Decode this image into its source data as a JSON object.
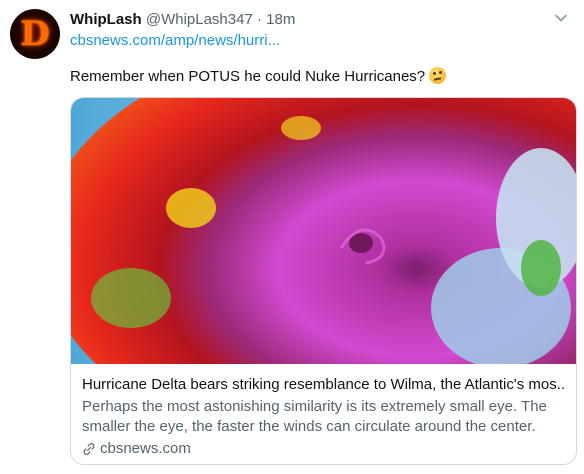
{
  "tweet": {
    "display_name": "WhipLash",
    "handle": "@WhipLash347",
    "separator": "·",
    "timestamp": "18m",
    "link_text": "cbsnews.com/amp/news/hurri...",
    "body_text": "Remember when POTUS he could Nuke Hurricanes?",
    "avatar_letter": "D"
  },
  "card": {
    "title": "Hurricane Delta bears striking resemblance to Wilma, the Atlantic's mos...",
    "description": "Perhaps the most astonishing similarity is its extremely small eye. The smaller the eye, the faster the winds can circulate around the center.",
    "source": "cbsnews.com"
  },
  "icons": {
    "more": "chevron-down-icon",
    "emoji": "thinking-face-emoji",
    "link": "link-icon"
  },
  "colors": {
    "link": "#1b95e0",
    "secondary_text": "#536471",
    "border": "#cfd9de"
  }
}
